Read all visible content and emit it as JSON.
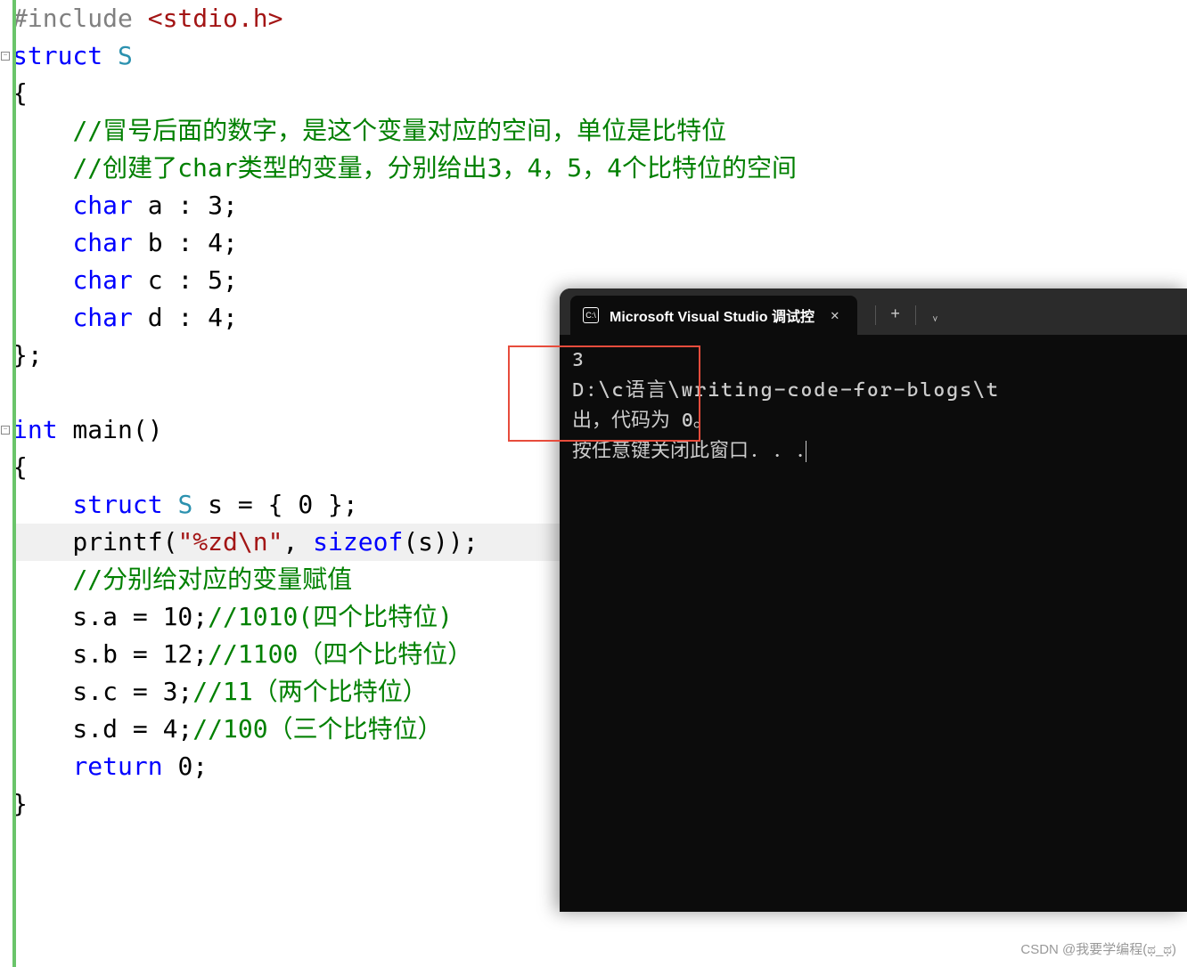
{
  "editor": {
    "lines": [
      {
        "tokens": [
          {
            "t": "#include ",
            "c": "preprocessor"
          },
          {
            "t": "<stdio.h>",
            "c": "str-angle"
          }
        ]
      },
      {
        "fold": true,
        "tokens": [
          {
            "t": "struct",
            "c": "kw-blue"
          },
          {
            "t": " S",
            "c": "kw-teal"
          }
        ]
      },
      {
        "tokens": [
          {
            "t": "{",
            "c": ""
          }
        ]
      },
      {
        "tokens": [
          {
            "t": "    ",
            "c": ""
          },
          {
            "t": "//冒号后面的数字，是这个变量对应的空间，单位是比特位",
            "c": "comment"
          }
        ]
      },
      {
        "tokens": [
          {
            "t": "    ",
            "c": ""
          },
          {
            "t": "//创建了char类型的变量，分别给出3，4，5，4个比特位的空间",
            "c": "comment"
          }
        ]
      },
      {
        "tokens": [
          {
            "t": "    ",
            "c": ""
          },
          {
            "t": "char",
            "c": "kw-blue"
          },
          {
            "t": " a : 3;",
            "c": ""
          }
        ]
      },
      {
        "tokens": [
          {
            "t": "    ",
            "c": ""
          },
          {
            "t": "char",
            "c": "kw-blue"
          },
          {
            "t": " b : 4;",
            "c": ""
          }
        ]
      },
      {
        "tokens": [
          {
            "t": "    ",
            "c": ""
          },
          {
            "t": "char",
            "c": "kw-blue"
          },
          {
            "t": " c : 5;",
            "c": ""
          }
        ]
      },
      {
        "tokens": [
          {
            "t": "    ",
            "c": ""
          },
          {
            "t": "char",
            "c": "kw-blue"
          },
          {
            "t": " d : 4;",
            "c": ""
          }
        ]
      },
      {
        "tokens": [
          {
            "t": "};",
            "c": ""
          }
        ]
      },
      {
        "tokens": [
          {
            "t": "",
            "c": ""
          }
        ]
      },
      {
        "fold": true,
        "tokens": [
          {
            "t": "int",
            "c": "kw-blue"
          },
          {
            "t": " main()",
            "c": ""
          }
        ]
      },
      {
        "tokens": [
          {
            "t": "{",
            "c": ""
          }
        ]
      },
      {
        "tokens": [
          {
            "t": "    ",
            "c": ""
          },
          {
            "t": "struct",
            "c": "kw-blue"
          },
          {
            "t": " S",
            "c": "kw-teal"
          },
          {
            "t": " s = { 0 };",
            "c": ""
          }
        ]
      },
      {
        "hl": true,
        "tokens": [
          {
            "t": "    printf(",
            "c": ""
          },
          {
            "t": "\"%zd",
            "c": "kw-pink"
          },
          {
            "t": "\\n",
            "c": "str-angle"
          },
          {
            "t": "\"",
            "c": "kw-pink"
          },
          {
            "t": ", ",
            "c": ""
          },
          {
            "t": "sizeof",
            "c": "kw-blue"
          },
          {
            "t": "(s));",
            "c": ""
          }
        ]
      },
      {
        "tokens": [
          {
            "t": "    ",
            "c": ""
          },
          {
            "t": "//分别给对应的变量赋值",
            "c": "comment"
          }
        ]
      },
      {
        "tokens": [
          {
            "t": "    s.a = 10;",
            "c": ""
          },
          {
            "t": "//1010(四个比特位)",
            "c": "comment"
          }
        ]
      },
      {
        "tokens": [
          {
            "t": "    s.b = 12;",
            "c": ""
          },
          {
            "t": "//1100（四个比特位）",
            "c": "comment"
          }
        ]
      },
      {
        "tokens": [
          {
            "t": "    s.c = 3;",
            "c": ""
          },
          {
            "t": "//11（两个比特位）",
            "c": "comment"
          }
        ]
      },
      {
        "tokens": [
          {
            "t": "    s.d = 4;",
            "c": ""
          },
          {
            "t": "//100（三个比特位）",
            "c": "comment"
          }
        ]
      },
      {
        "tokens": [
          {
            "t": "    ",
            "c": ""
          },
          {
            "t": "return",
            "c": "kw-blue"
          },
          {
            "t": " 0;",
            "c": ""
          }
        ]
      },
      {
        "tokens": [
          {
            "t": "}",
            "c": ""
          }
        ]
      }
    ]
  },
  "terminal": {
    "tab_title": "Microsoft Visual Studio 调试控",
    "tab_icon_text": "C:\\",
    "output": [
      "3",
      "",
      "D:\\c语言\\writing-code-for-blogs\\t",
      "出，代码为 0。",
      "按任意键关闭此窗口. . ."
    ]
  },
  "watermark": "CSDN @我要学编程(ಥ_ಥ)"
}
